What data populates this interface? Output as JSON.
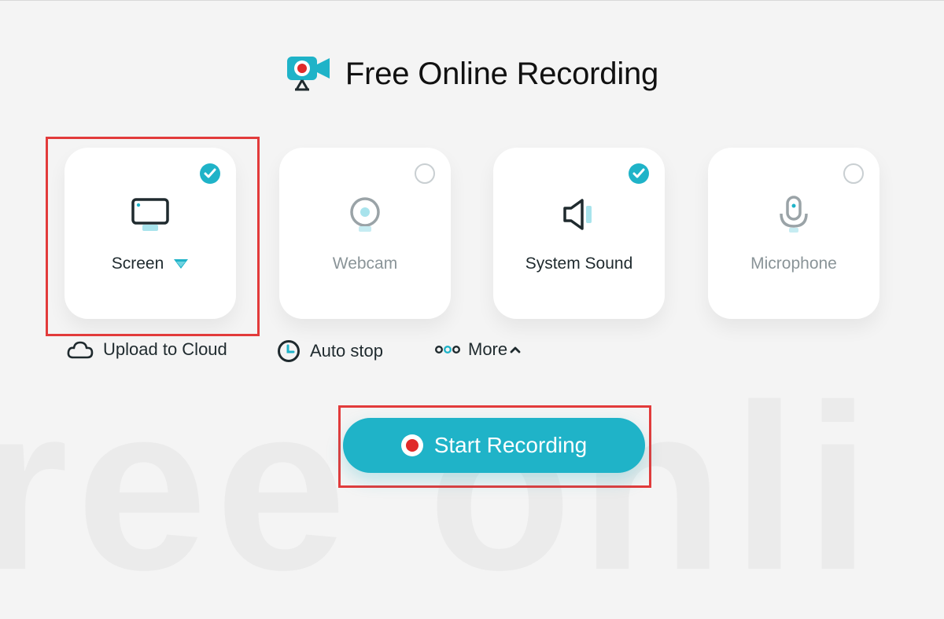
{
  "page": {
    "title": "Free Online Recording",
    "logo_icon": "video-camera-record-icon"
  },
  "sources": [
    {
      "label": "Screen",
      "checked": true,
      "icon": "monitor-icon",
      "has_dropdown": true
    },
    {
      "label": "Webcam",
      "checked": false,
      "icon": "webcam-icon"
    },
    {
      "label": "System Sound",
      "checked": true,
      "icon": "speaker-icon"
    },
    {
      "label": "Microphone",
      "checked": false,
      "icon": "microphone-icon"
    }
  ],
  "options": {
    "upload_label": "Upload to Cloud",
    "autostop_label": "Auto stop",
    "more_label": "More"
  },
  "start_button": {
    "label": "Start Recording"
  },
  "watermark": "ree onli",
  "colors": {
    "accent": "#1fb3c8",
    "record_red": "#e02a2a",
    "highlight_red": "#e23b3b",
    "background": "#f4f4f4"
  }
}
